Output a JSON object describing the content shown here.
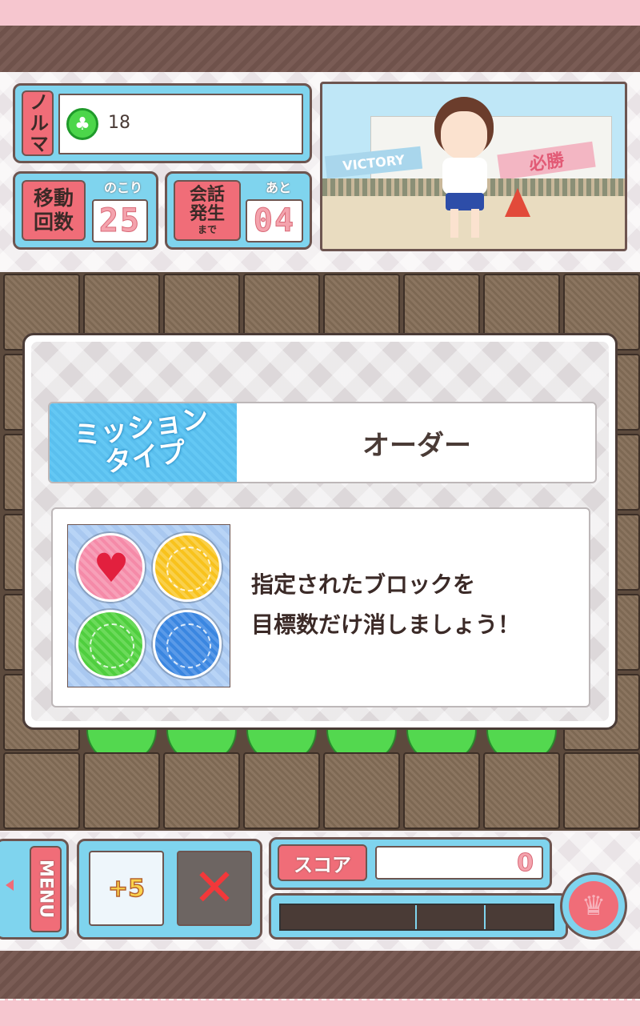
{
  "hud": {
    "norma_label": "ノルマ",
    "norma_value": "18",
    "moves_label_line1": "移動",
    "moves_label_line2": "回数",
    "moves_sub": "のこり",
    "moves_value": "25",
    "talk_label_line1": "会話",
    "talk_label_line2": "発生",
    "talk_label_line3": "まで",
    "talk_sub": "あと",
    "talk_value": "04"
  },
  "scene": {
    "banner_left": "VICTORY",
    "banner_right": "必勝"
  },
  "mission": {
    "type_label_line1": "ミッション",
    "type_label_line2": "タイプ",
    "type_value": "オーダー",
    "description_line1": "指定されたブロックを",
    "description_line2": "目標数だけ消しましょう！"
  },
  "bottom": {
    "menu_label": "MENU",
    "bonus_label": "+5",
    "score_label": "スコア",
    "score_value": "0"
  },
  "colors": {
    "accent_blue": "#7fd4ee",
    "accent_red": "#f06d78",
    "frame_brown": "#6d5550"
  }
}
